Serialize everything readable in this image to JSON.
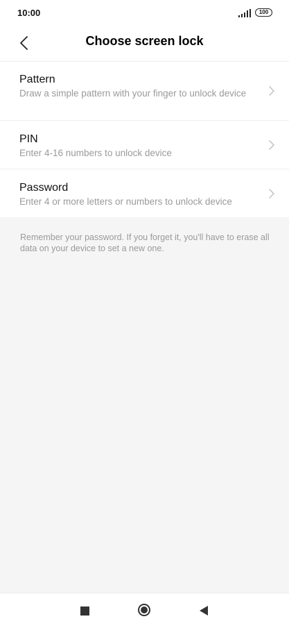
{
  "status_bar": {
    "time": "10:00",
    "battery": "100"
  },
  "header": {
    "title": "Choose screen lock",
    "back_icon": "chevron-left-icon"
  },
  "options": [
    {
      "title": "Pattern",
      "subtitle": "Draw a simple pattern with your finger to unlock device"
    },
    {
      "title": "PIN",
      "subtitle": "Enter 4-16 numbers to unlock device"
    },
    {
      "title": "Password",
      "subtitle": "Enter 4 or more letters or numbers to unlock device"
    }
  ],
  "note": "Remember your password. If you forget it, you'll have to erase all data on your device to set a new one.",
  "nav": {
    "recents_icon": "square-icon",
    "home_icon": "circle-icon",
    "back_icon": "triangle-back-icon"
  },
  "colors": {
    "background": "#f5f5f5",
    "card": "#ffffff",
    "subtitle": "#9a9a9a"
  }
}
